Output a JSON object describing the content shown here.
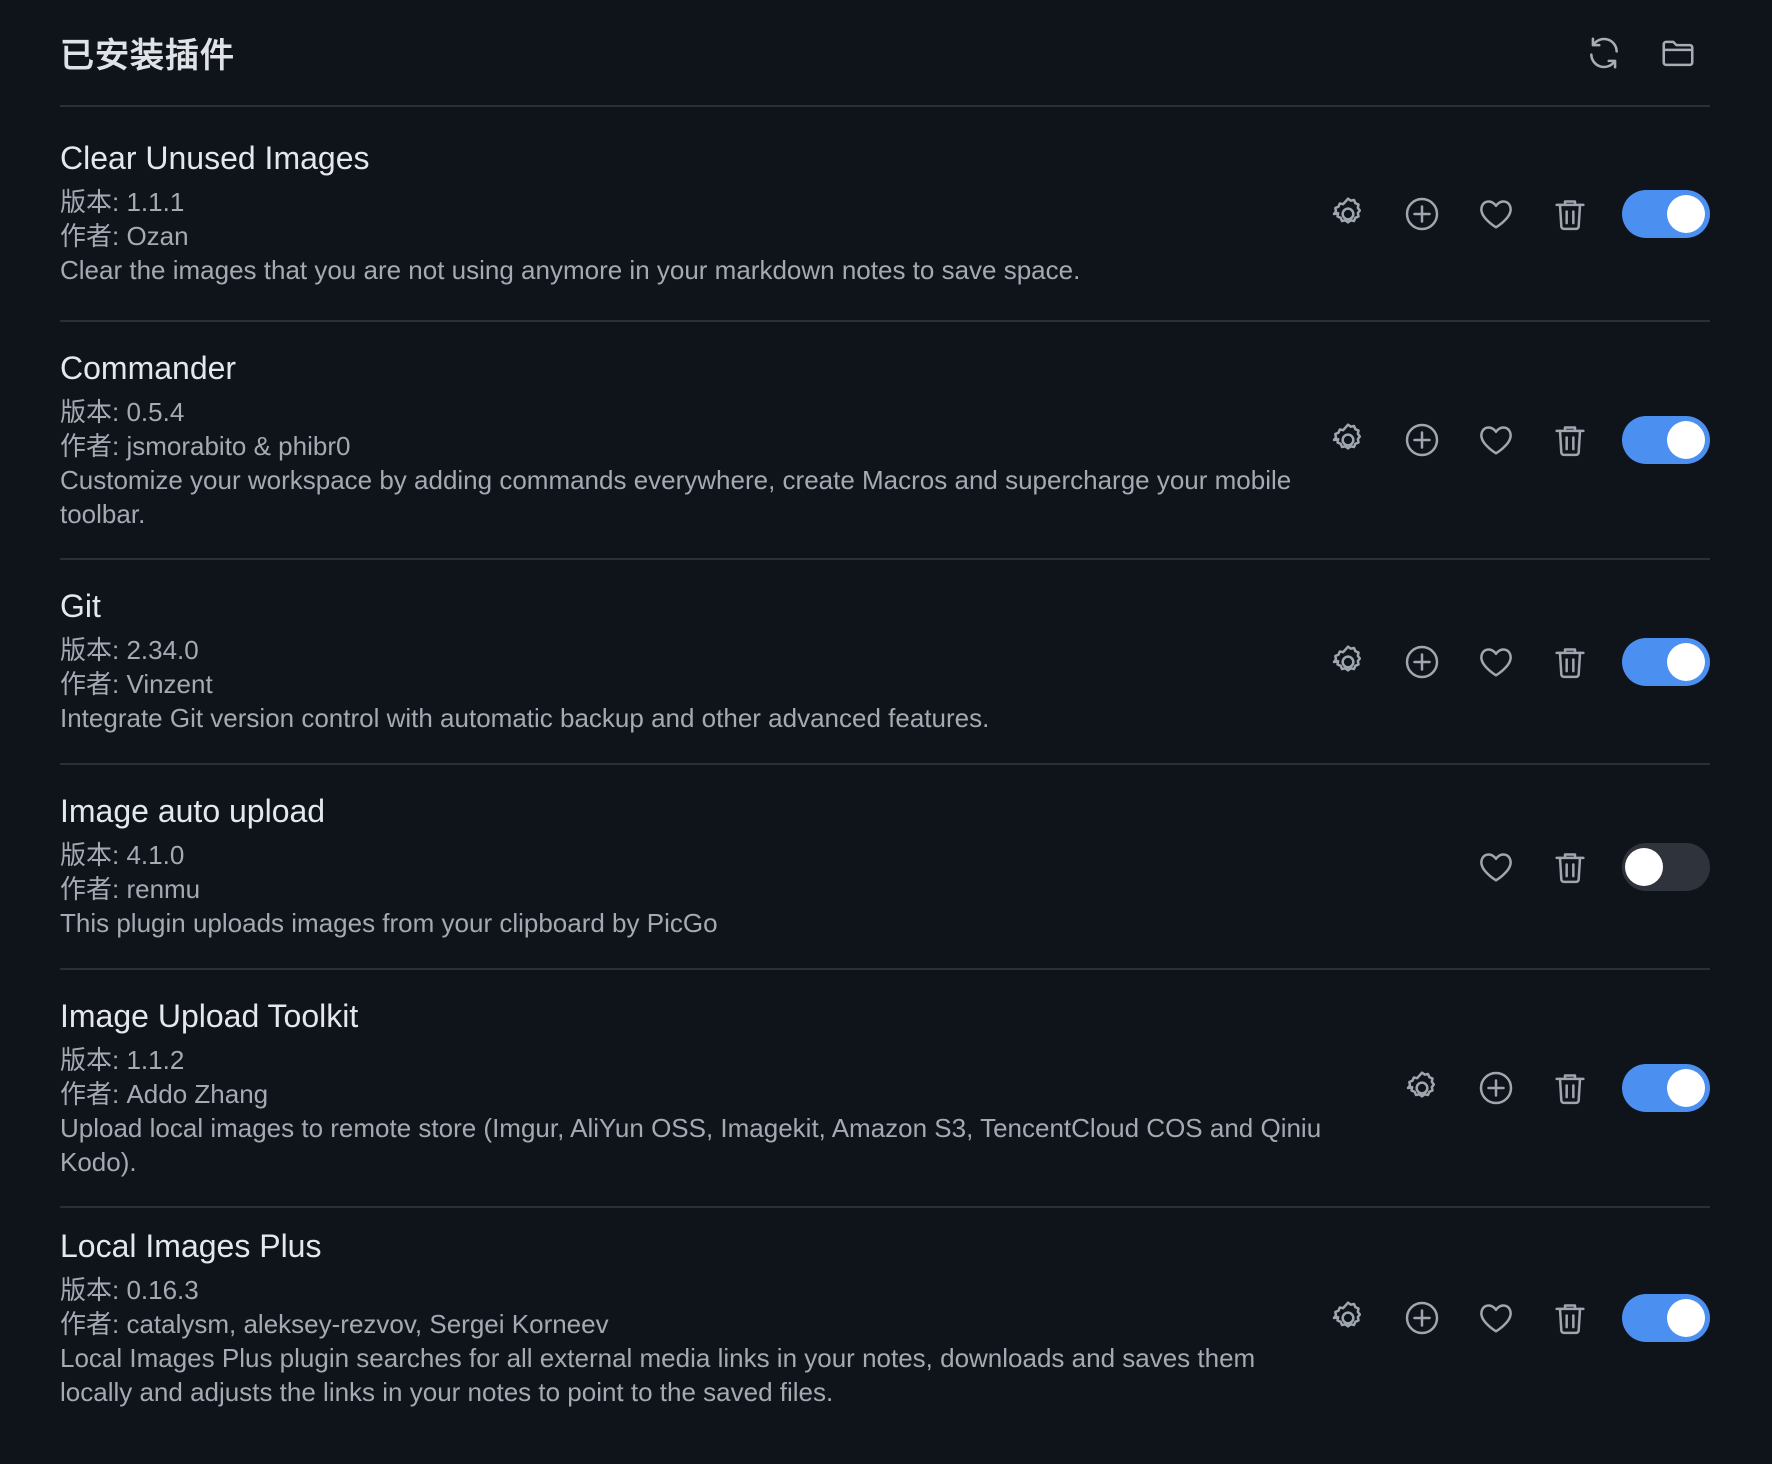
{
  "header": {
    "title": "已安装插件",
    "actions": [
      "refresh-icon",
      "folder-icon"
    ]
  },
  "labels": {
    "version_prefix": "版本: ",
    "author_prefix": "作者: "
  },
  "plugins": [
    {
      "name": "Clear Unused Images",
      "version": "版本: 1.1.1",
      "author": "作者:  Ozan",
      "description": "Clear the images that you are not using anymore in your markdown notes to save space.",
      "has_settings": true,
      "has_hotkeys": true,
      "has_favorite": true,
      "enabled": true
    },
    {
      "name": "Commander",
      "version": "版本: 0.5.4",
      "author": "作者:  jsmorabito & phibr0",
      "description": "Customize your workspace by adding commands everywhere, create Macros and supercharge your mobile toolbar.",
      "has_settings": true,
      "has_hotkeys": true,
      "has_favorite": true,
      "enabled": true
    },
    {
      "name": "Git",
      "version": "版本: 2.34.0",
      "author": "作者:  Vinzent",
      "description": "Integrate Git version control with automatic backup and other advanced features.",
      "has_settings": true,
      "has_hotkeys": true,
      "has_favorite": true,
      "enabled": true
    },
    {
      "name": "Image auto upload",
      "version": "版本: 4.1.0",
      "author": "作者:  renmu",
      "description": "This plugin uploads images from your clipboard by PicGo",
      "has_settings": false,
      "has_hotkeys": false,
      "has_favorite": true,
      "enabled": false
    },
    {
      "name": "Image Upload Toolkit",
      "version": "版本: 1.1.2",
      "author": "作者:  Addo Zhang",
      "description": "Upload local images to remote store (Imgur, AliYun OSS, Imagekit, Amazon S3, TencentCloud COS and Qiniu Kodo).",
      "has_settings": true,
      "has_hotkeys": true,
      "has_favorite": false,
      "enabled": true
    },
    {
      "name": "Local Images Plus",
      "version": "版本: 0.16.3",
      "author": "作者:  catalysm, aleksey-rezvov, Sergei Korneev",
      "description": "Local Images Plus plugin searches for all external media links in your notes, downloads and saves them locally and adjusts the links in your notes to point to the saved files.",
      "has_settings": true,
      "has_hotkeys": true,
      "has_favorite": true,
      "enabled": true
    }
  ]
}
